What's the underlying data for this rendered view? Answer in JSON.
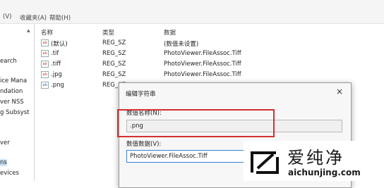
{
  "menu": {
    "items": [
      "(V)",
      "收藏夹(A)",
      "帮助(H)"
    ]
  },
  "tree": {
    "items": [
      {
        "label": "earch"
      },
      {
        "label": "ice Mana"
      },
      {
        "label": "ndation"
      },
      {
        "label": "ver NSS"
      },
      {
        "label": "g Subsyst"
      },
      {
        "label": "ver"
      },
      {
        "label": "ns"
      },
      {
        "label": "evices"
      }
    ]
  },
  "list": {
    "headers": {
      "name": "名称",
      "type": "类型",
      "data": "数据"
    },
    "rows": [
      {
        "name": "(默认)",
        "type": "REG_SZ",
        "data": "(数值未设置)",
        "icon": "ab"
      },
      {
        "name": ".tif",
        "type": "REG_SZ",
        "data": "PhotoViewer.FileAssoc.Tiff",
        "icon": "ab"
      },
      {
        "name": ".tiff",
        "type": "REG_SZ",
        "data": "PhotoViewer.FileAssoc.Tiff",
        "icon": "ab"
      },
      {
        "name": ".jpg",
        "type": "REG_SZ",
        "data": "PhotoViewer.FileAssoc.Tiff",
        "icon": "ab"
      },
      {
        "name": ".png",
        "type": "REG_SZ",
        "data": "",
        "icon": "ab"
      }
    ]
  },
  "dialog": {
    "title": "编辑字符串",
    "close_glyph": "×",
    "name_label": "数值名称(N):",
    "name_value": ".png",
    "data_label": "数值数据(V):",
    "data_value": "PhotoViewer.FileAssoc.Tiff"
  },
  "watermark": {
    "chinese": "爱纯净",
    "url": "aichunjing.com"
  }
}
